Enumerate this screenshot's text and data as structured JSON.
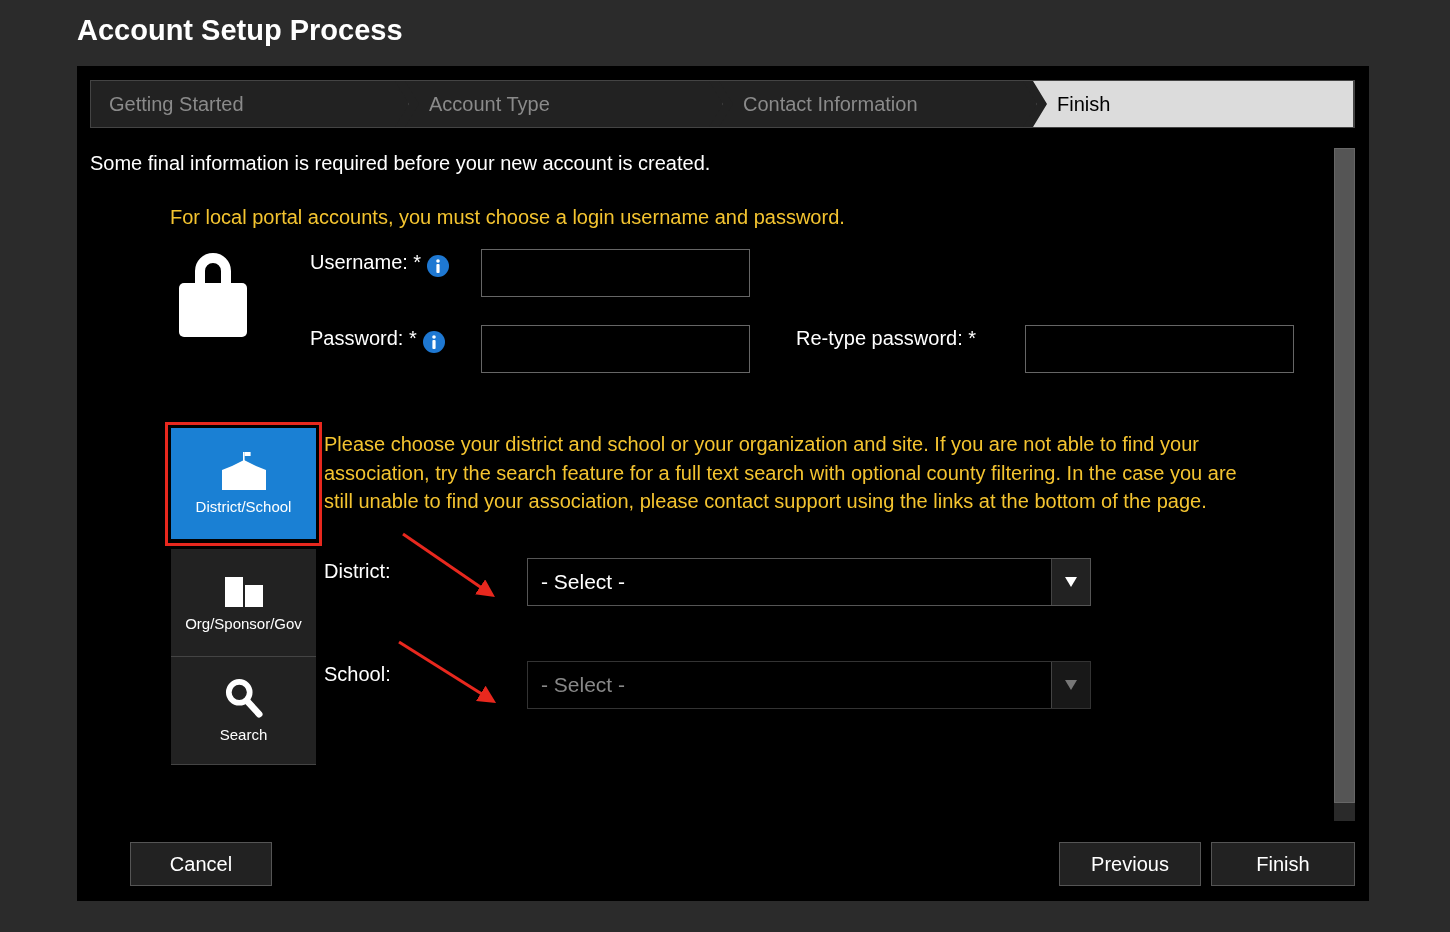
{
  "title": "Account Setup Process",
  "steps": [
    {
      "label": "Getting Started",
      "selected": false
    },
    {
      "label": "Account Type",
      "selected": false
    },
    {
      "label": "Contact Information",
      "selected": false
    },
    {
      "label": "Finish",
      "selected": true
    }
  ],
  "intro": "Some final information is required before your new account is created.",
  "credentials_note": "For local portal accounts, you must choose a login username and password.",
  "credential_rows": [
    [
      {
        "label": "Username: *",
        "info": true
      }
    ],
    [
      {
        "label": "Password: *",
        "info": true
      },
      {
        "label": "Re-type password: *",
        "info": false
      }
    ]
  ],
  "org_types": [
    {
      "label": "District/School",
      "kind": "school",
      "selected": true
    },
    {
      "label": "Org/Sponsor/Gov",
      "kind": "buildings",
      "selected": false
    },
    {
      "label": "Search",
      "kind": "search",
      "selected": false
    }
  ],
  "org_note": "Please choose your district and school or your organization and site. If you are not able to find your association, try the search feature for a full text search with optional county filtering. In the case you are still unable to find your association, please contact support using the links at the bottom of the page.",
  "selects": [
    {
      "label": "District:",
      "value": "- Select -",
      "disabled": false
    },
    {
      "label": "School:",
      "value": "- Select -",
      "disabled": true
    }
  ],
  "buttons": {
    "cancel": "Cancel",
    "previous": "Previous",
    "finish": "Finish"
  }
}
